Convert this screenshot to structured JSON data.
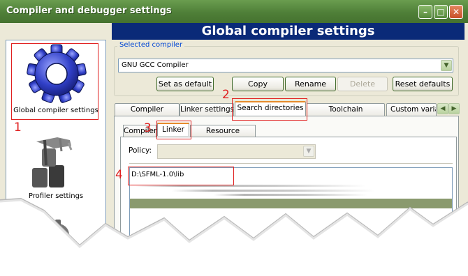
{
  "window": {
    "title": "Compiler and debugger settings"
  },
  "banner": {
    "title": "Global compiler settings"
  },
  "sidebar": {
    "items": [
      {
        "label": "Global compiler settings",
        "icon": "gear-icon"
      },
      {
        "label": "Profiler settings",
        "icon": "profiler-icon"
      }
    ]
  },
  "selected_compiler": {
    "group_label": "Selected compiler",
    "value": "GNU GCC Compiler"
  },
  "buttons": {
    "set_default": "Set as default",
    "copy": "Copy",
    "rename": "Rename",
    "delete": "Delete",
    "reset": "Reset defaults"
  },
  "tabs": [
    {
      "label": "Compiler settings"
    },
    {
      "label": "Linker settings"
    },
    {
      "label": "Search directories",
      "selected": true
    },
    {
      "label": "Toolchain executables"
    },
    {
      "label": "Custom variables"
    }
  ],
  "subtabs": [
    {
      "label": "Compiler"
    },
    {
      "label": "Linker",
      "selected": true
    },
    {
      "label": "Resource compiler"
    }
  ],
  "policy": {
    "label": "Policy:",
    "value": ""
  },
  "directories": [
    "D:\\SFML-1.0\\lib"
  ],
  "annotations": [
    "1",
    "2",
    "3",
    "4"
  ],
  "colors": {
    "annotation": "#e02020",
    "banner": "#0a2a78",
    "titlebar": "#4f7f38"
  }
}
